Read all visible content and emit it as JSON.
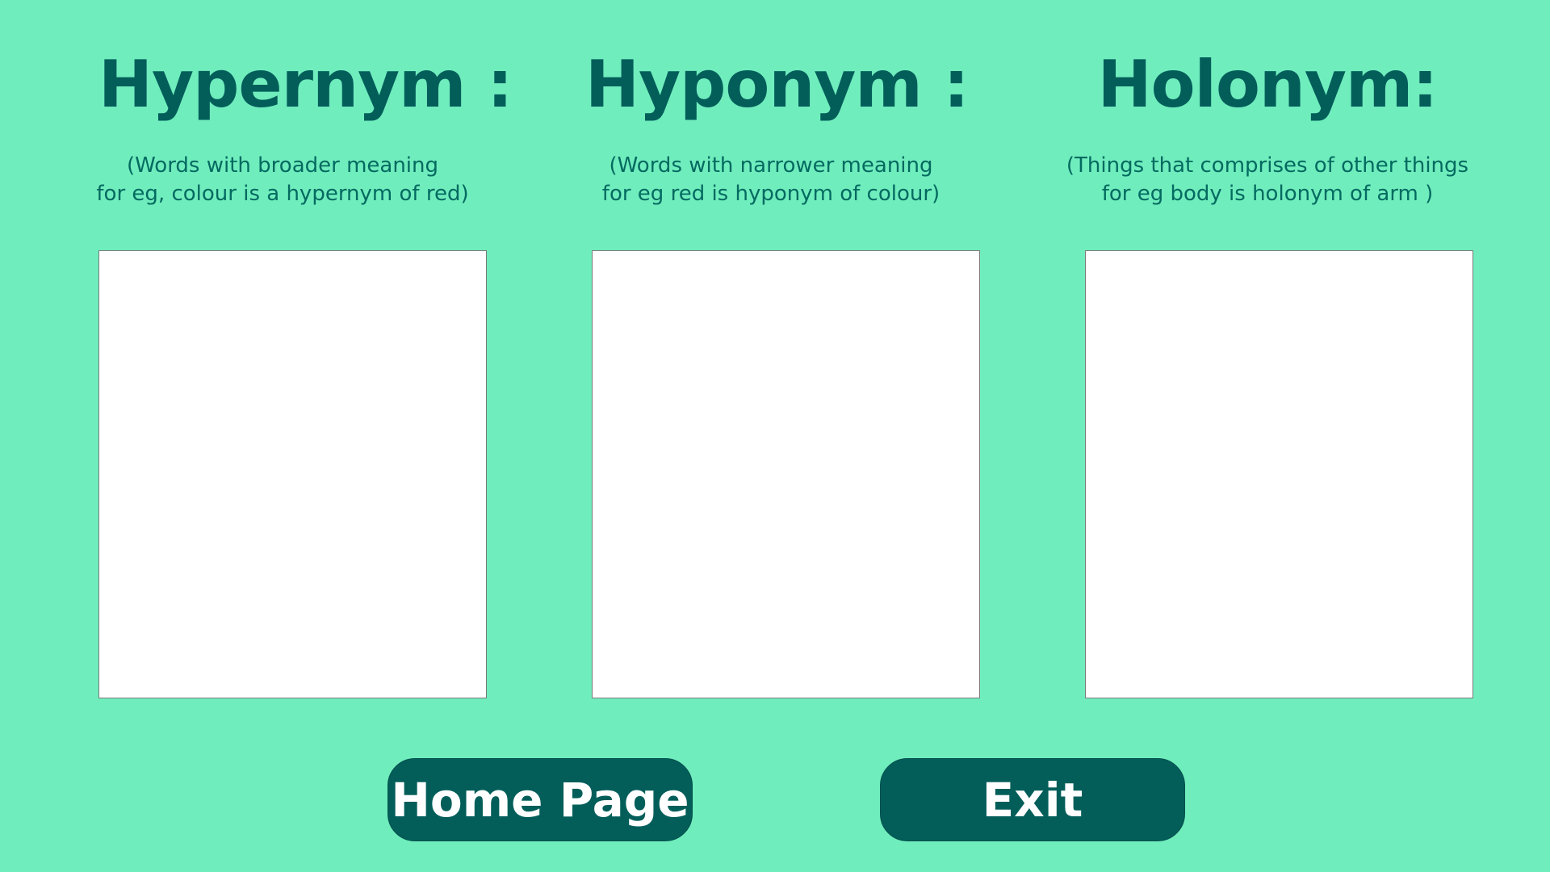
{
  "columns": [
    {
      "title": "Hypernym :",
      "description": "(Words with broader meaning\nfor eg, colour is a hypernym of red)"
    },
    {
      "title": "Hyponym :",
      "description": "(Words with narrower meaning\nfor eg red is hyponym of colour)"
    },
    {
      "title": "Holonym:",
      "description": "(Things that comprises of other things\nfor eg body is holonym of arm )"
    }
  ],
  "buttons": {
    "home_label": "Home Page",
    "exit_label": "Exit"
  },
  "colors": {
    "background": "#70edbd",
    "title_text": "#035e5a",
    "button_bg": "#035e5a",
    "button_text": "#ffffff",
    "box_bg": "#ffffff"
  }
}
